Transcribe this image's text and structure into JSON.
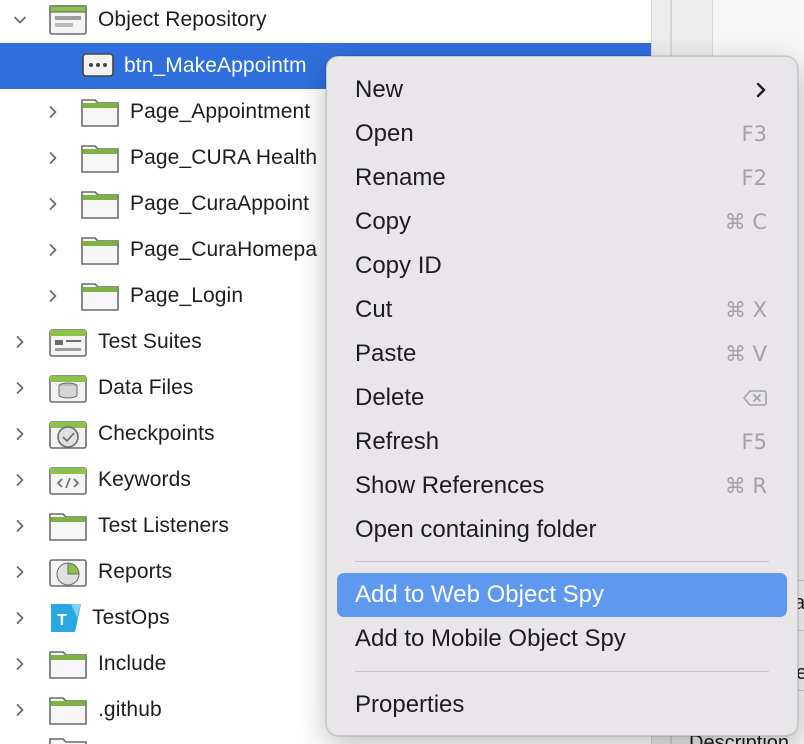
{
  "tree": {
    "items": [
      {
        "label": "Object Repository",
        "expanded": true,
        "icon": "repository-folder-icon"
      },
      {
        "label": "btn_MakeAppointm",
        "icon": "test-object-icon",
        "selected": true
      },
      {
        "label": "Page_Appointment",
        "icon": "folder-icon"
      },
      {
        "label": "Page_CURA Health",
        "icon": "folder-icon"
      },
      {
        "label": "Page_CuraAppoint",
        "icon": "folder-icon"
      },
      {
        "label": "Page_CuraHomepa",
        "icon": "folder-icon"
      },
      {
        "label": "Page_Login",
        "icon": "folder-icon"
      },
      {
        "label": "Test Suites",
        "icon": "test-suites-icon"
      },
      {
        "label": "Data Files",
        "icon": "data-files-icon"
      },
      {
        "label": "Checkpoints",
        "icon": "checkpoints-icon"
      },
      {
        "label": "Keywords",
        "icon": "keywords-icon"
      },
      {
        "label": "Test Listeners",
        "icon": "folder-icon"
      },
      {
        "label": "Reports",
        "icon": "reports-icon"
      },
      {
        "label": "TestOps",
        "icon": "testops-icon"
      },
      {
        "label": "Include",
        "icon": "folder-icon"
      },
      {
        "label": ".github",
        "icon": "folder-icon"
      }
    ]
  },
  "right_panel": {
    "fragments": [
      "a",
      "e",
      "Description"
    ]
  },
  "context_menu": {
    "items": [
      {
        "label": "New",
        "shortcut": "",
        "submenu": true
      },
      {
        "label": "Open",
        "shortcut": "F3"
      },
      {
        "label": "Rename",
        "shortcut": "F2"
      },
      {
        "label": "Copy",
        "shortcut": "⌘ C"
      },
      {
        "label": "Copy ID",
        "shortcut": ""
      },
      {
        "label": "Cut",
        "shortcut": "⌘ X"
      },
      {
        "label": "Paste",
        "shortcut": "⌘ V"
      },
      {
        "label": "Delete",
        "shortcut": "",
        "shortcut_icon": "delete-key-icon"
      },
      {
        "label": "Refresh",
        "shortcut": "F5"
      },
      {
        "label": "Show References",
        "shortcut": "⌘ R"
      },
      {
        "label": "Open containing folder",
        "shortcut": ""
      },
      {
        "label": "Add to Web Object Spy",
        "shortcut": "",
        "highlighted": true
      },
      {
        "label": "Add to Mobile Object Spy",
        "shortcut": ""
      },
      {
        "label": "Properties",
        "shortcut": ""
      }
    ]
  },
  "colors": {
    "selection": "#2f6fdd",
    "menu_highlight": "#5f98ef",
    "menu_bg": "#e8e6e9",
    "folder_green": "#6aa84f"
  }
}
